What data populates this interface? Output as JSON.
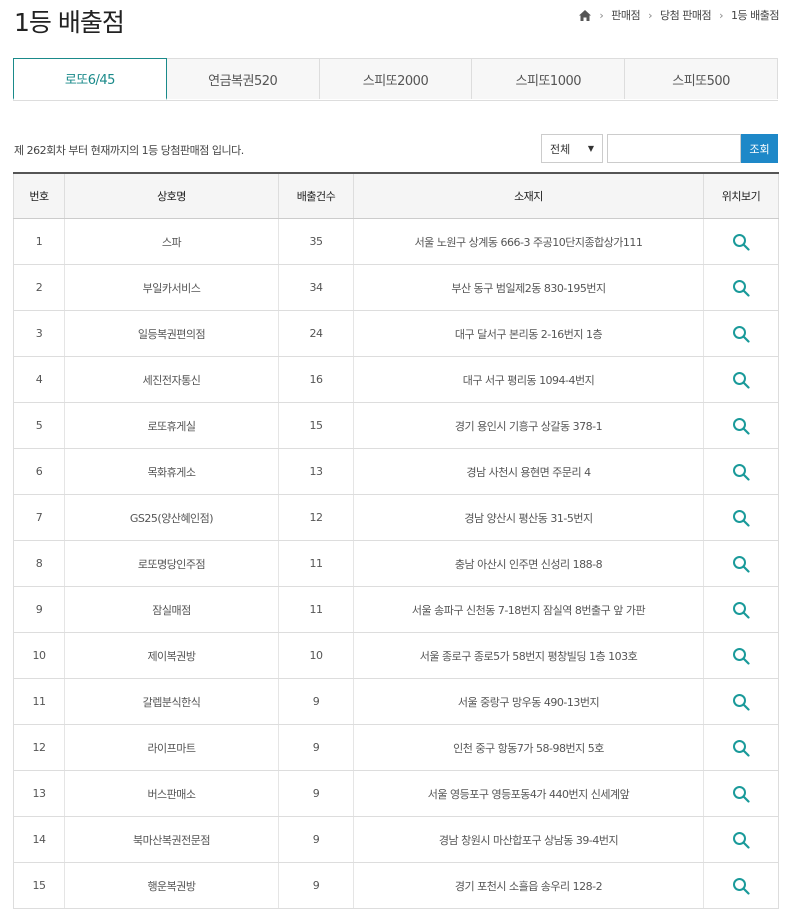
{
  "page": {
    "title": "1등 배출점"
  },
  "breadcrumb": {
    "items": [
      "판매점",
      "당첨 판매점",
      "1등 배출점"
    ]
  },
  "tabs": [
    {
      "label": "로또6/45",
      "active": true
    },
    {
      "label": "연금복권520",
      "active": false
    },
    {
      "label": "스피또2000",
      "active": false
    },
    {
      "label": "스피또1000",
      "active": false
    },
    {
      "label": "스피또500",
      "active": false
    }
  ],
  "info": {
    "text": "제 262회차 부터 현재까지의 1등 당첨판매점 입니다."
  },
  "search": {
    "select_value": "전체",
    "input_value": "",
    "button_label": "조회"
  },
  "table": {
    "headers": [
      "번호",
      "상호명",
      "배출건수",
      "소재지",
      "위치보기"
    ],
    "rows": [
      [
        "1",
        "스파",
        "35",
        "서울 노원구 상계동 666-3 주공10단지종합상가111"
      ],
      [
        "2",
        "부일카서비스",
        "34",
        "부산 동구 범일제2동 830-195번지"
      ],
      [
        "3",
        "일등복권편의점",
        "24",
        "대구 달서구 본리동 2-16번지 1층"
      ],
      [
        "4",
        "세진전자통신",
        "16",
        "대구 서구 평리동 1094-4번지"
      ],
      [
        "5",
        "로또휴게실",
        "15",
        "경기 용인시 기흥구 상갈동 378-1"
      ],
      [
        "6",
        "목화휴게소",
        "13",
        "경남 사천시 용현면 주문리 4"
      ],
      [
        "7",
        "GS25(양산혜인점)",
        "12",
        "경남 양산시 평산동 31-5번지"
      ],
      [
        "8",
        "로또명당인주점",
        "11",
        "충남 아산시 인주면 신성리 188-8"
      ],
      [
        "9",
        "잠실매점",
        "11",
        "서울 송파구 신천동 7-18번지 잠실역 8번출구 앞 가판"
      ],
      [
        "10",
        "제이복권방",
        "10",
        "서울 종로구 종로5가 58번지 평창빌딩 1층 103호"
      ],
      [
        "11",
        "갈렙분식한식",
        "9",
        "서울 중랑구 망우동 490-13번지"
      ],
      [
        "12",
        "라이프마트",
        "9",
        "인천 중구 항동7가 58-98번지 5호"
      ],
      [
        "13",
        "버스판매소",
        "9",
        "서울 영등포구 영등포동4가 440번지 신세계앞"
      ],
      [
        "14",
        "북마산복권전문점",
        "9",
        "경남 창원시 마산합포구 상남동 39-4번지"
      ],
      [
        "15",
        "행운복권방",
        "9",
        "경기 포천시 소흘읍 송우리 128-2"
      ]
    ]
  },
  "icons": {
    "home": "home-icon",
    "locate": "search-magnifier-icon"
  },
  "colors": {
    "accent": "#1a8a8a",
    "button": "#1e88c8",
    "icon": "#1a9a9a"
  }
}
